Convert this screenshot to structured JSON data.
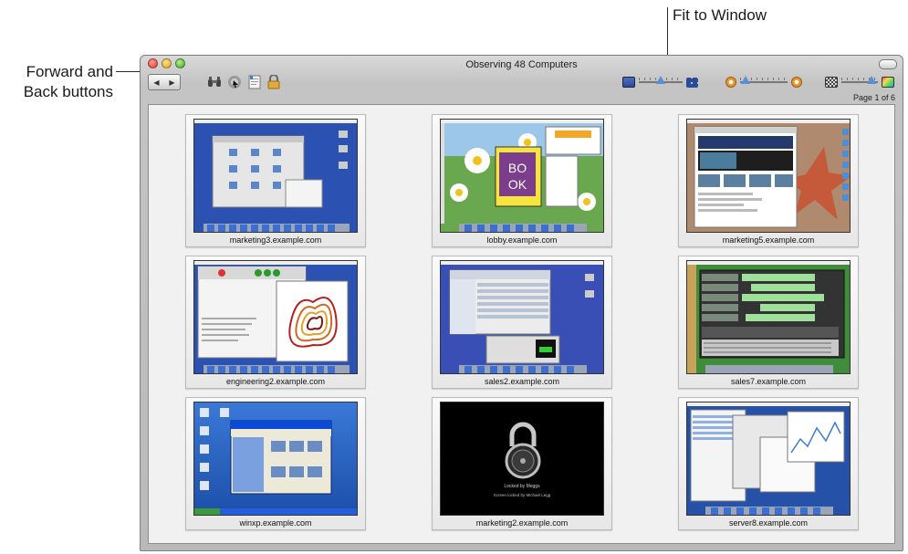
{
  "callouts": {
    "nav_line1": "Forward and",
    "nav_line2": "Back buttons",
    "fit": "Fit to Window"
  },
  "window": {
    "title": "Observing 48 Computers",
    "page_label": "Page 1 of 6"
  },
  "toolbar": {
    "back_glyph": "◀",
    "forward_glyph": "▶",
    "icons": [
      "binoculars-icon",
      "observe-icon",
      "notes-icon",
      "lock-icon"
    ]
  },
  "tiles": [
    {
      "label": "marketing3.example.com"
    },
    {
      "label": "lobby.example.com"
    },
    {
      "label": "marketing5.example.com"
    },
    {
      "label": "engineering2.example.com"
    },
    {
      "label": "sales2.example.com"
    },
    {
      "label": "sales7.example.com"
    },
    {
      "label": "winxp.example.com"
    },
    {
      "label": "marketing2.example.com"
    },
    {
      "label": "server8.example.com"
    }
  ],
  "lock_screen": {
    "line1": "Locked by Meggs",
    "line2": "Screen locked by Michael Legg"
  },
  "colors": {
    "accent": "#5a8fd6",
    "desktop_blue": "#2b52b3",
    "desktop_green": "#3f8c3a"
  }
}
